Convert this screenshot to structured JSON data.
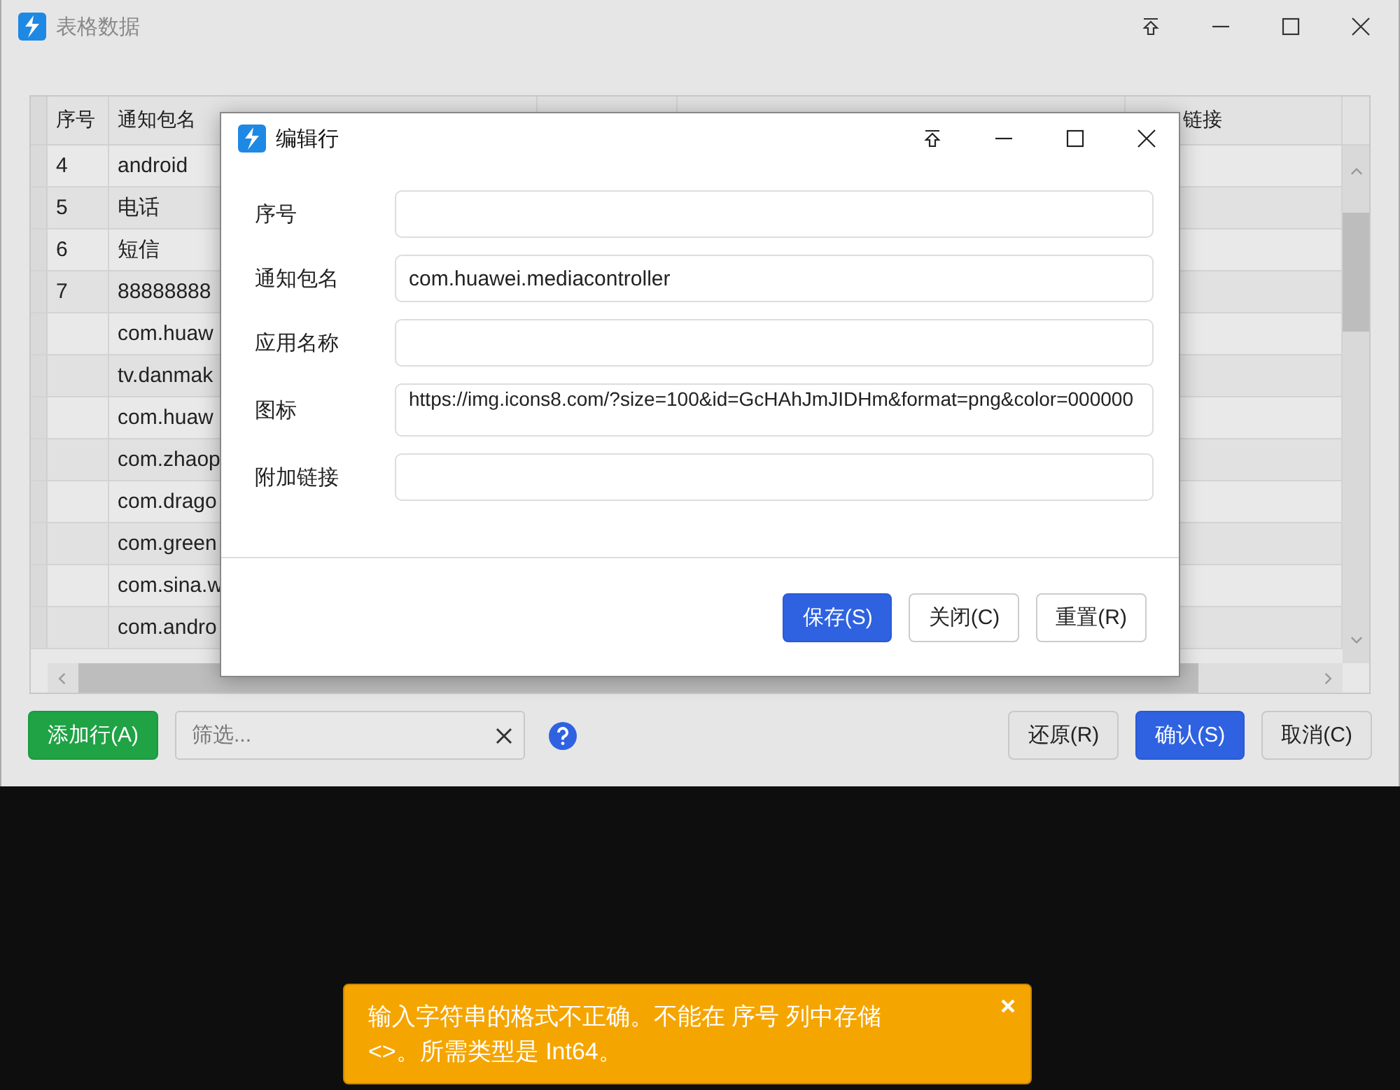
{
  "window": {
    "title": "表格数据"
  },
  "table": {
    "columns": [
      {
        "label": "序号"
      },
      {
        "label": "通知包名"
      },
      {},
      {},
      {
        "label": "链接"
      }
    ],
    "rows": [
      {
        "number": "4",
        "package": "android"
      },
      {
        "number": "5",
        "package": "电话"
      },
      {
        "number": "6",
        "package": "短信"
      },
      {
        "number": "7",
        "package": "88888888"
      },
      {
        "package": "com.huaw"
      },
      {
        "package": "tv.danmak"
      },
      {
        "package": "com.huaw"
      },
      {
        "package": "com.zhaop"
      },
      {
        "package": "com.drago"
      },
      {
        "package": "com.green"
      },
      {
        "package": "com.sina.w"
      },
      {
        "package": "com.andro"
      }
    ]
  },
  "toolbar": {
    "add_button": "添加行(A)",
    "filter": {
      "placeholder": "筛选..."
    },
    "buttons": [
      {
        "label": "还原(R)",
        "primary": false
      },
      {
        "label": "确认(S)",
        "primary": true
      },
      {
        "label": "取消(C)",
        "primary": false
      }
    ]
  },
  "dialog": {
    "title": "编辑行",
    "fields": [
      {
        "label": "序号"
      },
      {
        "label": "通知包名",
        "value": "com.huawei.mediacontroller"
      },
      {
        "label": "应用名称"
      },
      {
        "label": "图标",
        "value": "https://img.icons8.com/?size=100&id=GcHAhJmJIDHm&format=png&color=000000",
        "kind": "multiline"
      },
      {
        "label": "附加链接"
      }
    ],
    "buttons": [
      {
        "label": "保存(S)",
        "primary": true
      },
      {
        "label": "关闭(C)",
        "primary": false
      },
      {
        "label": "重置(R)",
        "primary": false
      }
    ]
  },
  "toast": {
    "message": "输入字符串的格式不正确。不能在 序号 列中存储 <>。所需类型是 Int64。"
  }
}
